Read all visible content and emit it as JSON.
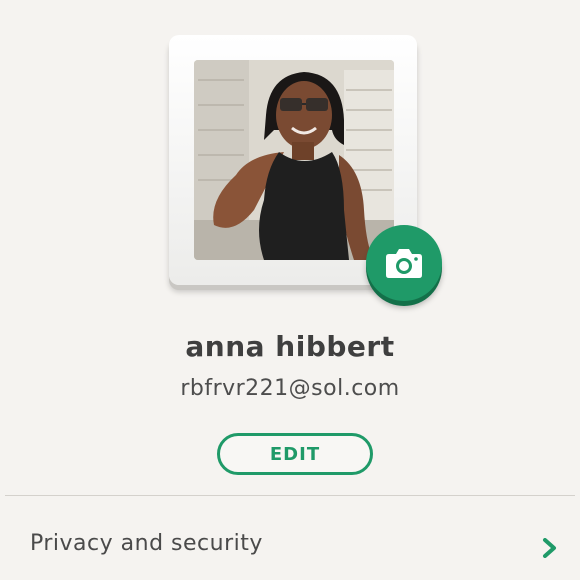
{
  "profile": {
    "name": "anna hibbert",
    "email": "rbfrvr221@sol.com",
    "photo_icon": "user-photo",
    "camera_icon": "camera-icon"
  },
  "actions": {
    "edit_label": "EDIT"
  },
  "menu": {
    "items": [
      {
        "label": "Privacy and security",
        "icon": "chevron-right-icon"
      }
    ]
  },
  "colors": {
    "accent": "#1f9a68",
    "background": "#f5f3f0",
    "text": "#4a4a4a"
  }
}
